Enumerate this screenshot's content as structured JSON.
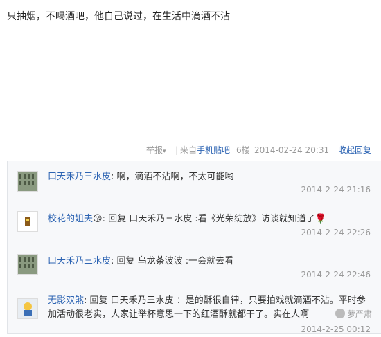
{
  "post": {
    "text": "只抽烟，不喝酒吧，他自己说过，在生活中滴酒不沾",
    "report_label": "举报",
    "separator": "|",
    "from_prefix": "来自",
    "from_client": "手机贴吧",
    "floor": "6楼",
    "time": "2014-02-24 20:31",
    "collapse_label": "收起回复"
  },
  "replies": [
    {
      "user": "口天禾乃三水皮",
      "colon": ": ",
      "content": "啊，滴酒不沾啊，不太可能哟",
      "time": "2014-2-24 21:16",
      "avatar": "avatar-rows"
    },
    {
      "user": "校花的姐夫",
      "emoji": "😘",
      "colon": ": ",
      "content": "回复 口天禾乃三水皮 :看《光荣绽放》访谈就知道了",
      "sticker": "🌹",
      "time": "2014-2-24 22:26",
      "avatar": "avatar-badge"
    },
    {
      "user": "口天禾乃三水皮",
      "colon": ": ",
      "content": "回复 乌龙茶波波 :一会就去看",
      "time": "2014-2-24 22:46",
      "avatar": "avatar-rows"
    },
    {
      "user": "无影双煞",
      "colon": ": ",
      "content": "回复 口天禾乃三水皮 ：是的酥很自律，只要拍戏就滴酒不沾。平时参加活动很老实，人家让举杯意思一下的红酒酥就都干了。实在人啊",
      "time": "2014-2-25 00:12",
      "avatar": "avatar-cartoon"
    }
  ],
  "watermark": {
    "text": "萝严肃"
  }
}
